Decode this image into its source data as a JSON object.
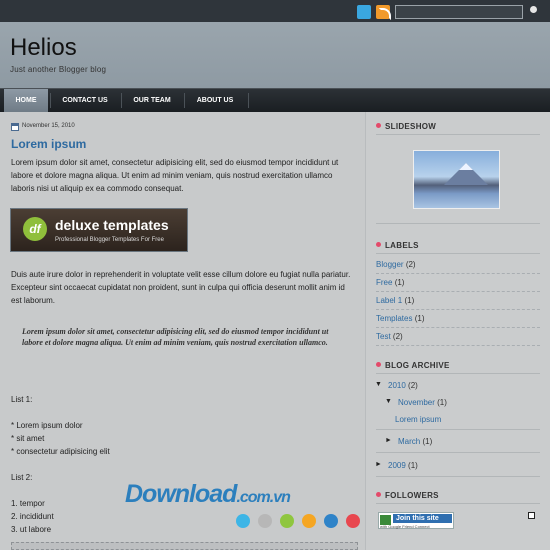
{
  "colors": {
    "accent": "#2e6aa0",
    "nav_bg": "#1f2428",
    "header_bg": "#95a1aa",
    "bullet": "#e34a6a"
  },
  "topbar": {
    "icons": [
      "twitter-icon",
      "rss-icon",
      "search-icon"
    ],
    "search_placeholder": ""
  },
  "header": {
    "title": "Helios",
    "tagline": "Just another Blogger blog"
  },
  "nav": {
    "tabs": [
      {
        "label": "HOME",
        "active": true
      },
      {
        "label": "CONTACT US",
        "active": false
      },
      {
        "label": "OUR TEAM",
        "active": false
      },
      {
        "label": "ABOUT US",
        "active": false
      }
    ]
  },
  "post": {
    "date": "November 15, 2010",
    "title": "Lorem ipsum",
    "para1": "Lorem ipsum dolor sit amet, consectetur adipisicing elit, sed do eiusmod tempor incididunt ut labore et dolore magna aliqua. Ut enim ad minim veniam, quis nostrud exercitation ullamco laboris nisi ut aliquip ex ea commodo consequat.",
    "banner": {
      "logo": "df",
      "title": "deluxe templates",
      "subtitle": "Professional Blogger Templates For Free"
    },
    "para2": "Duis aute irure dolor in reprehenderit in voluptate velit esse cillum dolore eu fugiat nulla pariatur. Excepteur sint occaecat cupidatat non proident, sunt in culpa qui officia deserunt mollit anim id est laborum.",
    "quote": "Lorem ipsum dolor sit amet, consectetur adipisicing elit, sed do eiusmod tempor incididunt ut labore et dolore magna aliqua. Ut enim ad minim veniam, quis nostrud exercitation ullamco.",
    "list1_title": "List 1:",
    "list1": [
      "* Lorem ipsum dolor",
      "* sit amet",
      "* consectetur adipisicing elit"
    ],
    "list2_title": "List 2:",
    "list2": [
      "1. tempor",
      "2. incididunt",
      "3. ut labore"
    ]
  },
  "sidebar": {
    "slideshow_title": "SLIDESHOW",
    "labels_title": "LABELS",
    "labels": [
      {
        "name": "Blogger",
        "count": "(2)"
      },
      {
        "name": "Free",
        "count": "(1)"
      },
      {
        "name": "Label 1",
        "count": "(1)"
      },
      {
        "name": "Templates",
        "count": "(1)"
      },
      {
        "name": "Test",
        "count": "(2)"
      }
    ],
    "archive_title": "BLOG ARCHIVE",
    "archive": {
      "year1": "2010",
      "year1_count": "(2)",
      "month1": "November",
      "month1_count": "(1)",
      "post1": "Lorem ipsum",
      "month2": "March",
      "month2_count": "(1)",
      "year2": "2009",
      "year2_count": "(1)"
    },
    "followers_title": "FOLLOWERS",
    "join_label": "Join this site",
    "join_sub": "with Google Friend Connect"
  },
  "watermark": {
    "text": "Download",
    "suffix": ".com.vn",
    "dot_colors": [
      "#3db5e6",
      "#b7b7b7",
      "#8fc63f",
      "#f5a623",
      "#2f83c8",
      "#e8474f"
    ]
  }
}
